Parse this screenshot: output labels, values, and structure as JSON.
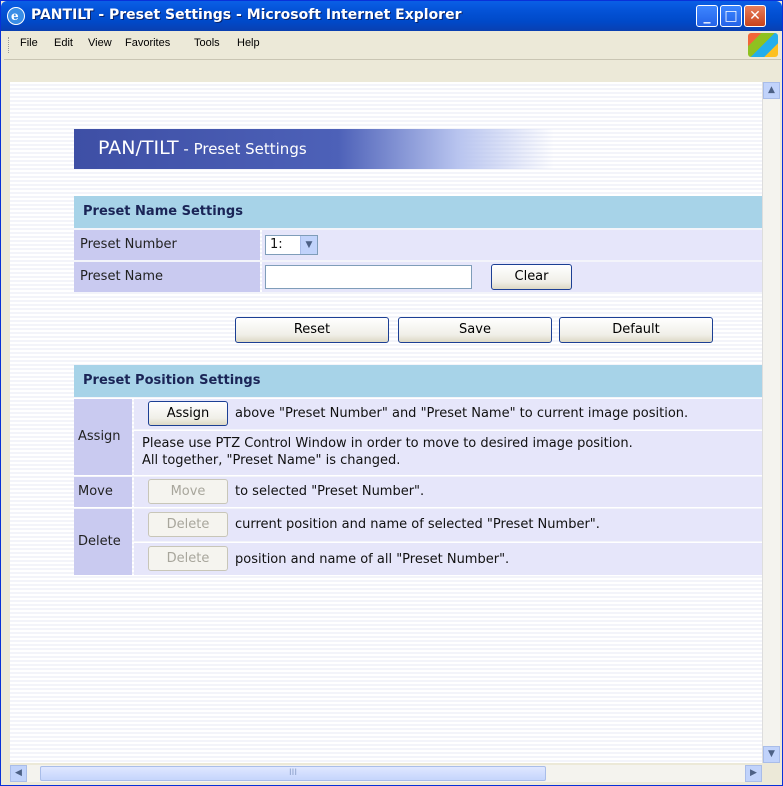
{
  "window": {
    "title": "PANTILT - Preset Settings - Microsoft Internet Explorer",
    "min_glyph": "_",
    "max_glyph": "□",
    "close_glyph": "✕"
  },
  "menu": {
    "items": [
      {
        "label": "File"
      },
      {
        "label": "Edit"
      },
      {
        "label": "View"
      },
      {
        "label": "Favorites"
      },
      {
        "label": "Tools"
      },
      {
        "label": "Help"
      }
    ]
  },
  "banner": {
    "main": "PAN/TILT",
    "sub": " - Preset Settings"
  },
  "name_section": {
    "header": "Preset Name Settings",
    "preset_number_label": "Preset Number",
    "preset_number_value": "1:",
    "preset_name_label": "Preset Name",
    "preset_name_value": "",
    "clear_label": "Clear"
  },
  "actions": {
    "reset_label": "Reset",
    "save_label": "Save",
    "default_label": "Default"
  },
  "position_section": {
    "header": "Preset Position Settings",
    "assign_label": "Assign",
    "assign_button": "Assign",
    "assign_text": "above \"Preset Number\" and \"Preset Name\" to current image position.",
    "assign_note_1": "Please use PTZ Control Window in order to move to desired image position.",
    "assign_note_2": "All together, \"Preset Name\" is changed.",
    "move_label": "Move",
    "move_button": "Move",
    "move_text": "to selected \"Preset Number\".",
    "delete_label": "Delete",
    "delete_button_1": "Delete",
    "delete_text_1": "current position and name of selected \"Preset Number\".",
    "delete_button_2": "Delete",
    "delete_text_2": "position and name of all \"Preset Number\"."
  },
  "scrollbar": {
    "up_glyph": "▲",
    "down_glyph": "▼",
    "left_glyph": "◀",
    "right_glyph": "▶",
    "grip_glyph": "III"
  },
  "colors": {
    "banner": "#3e4fa5",
    "section_header": "#a7d3e8",
    "label_cell": "#c9caf0",
    "value_cell": "#e6e6fa"
  }
}
